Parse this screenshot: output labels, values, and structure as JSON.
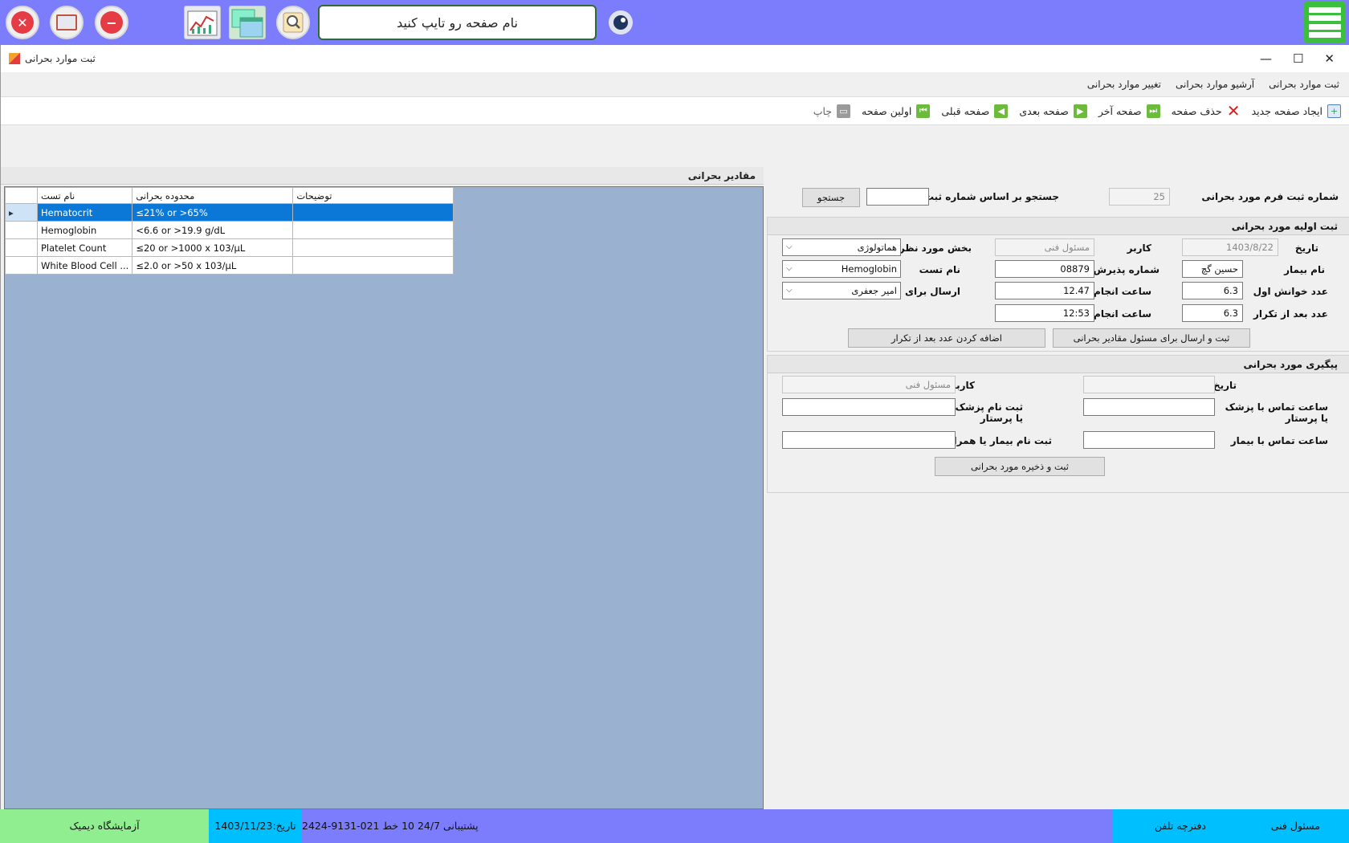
{
  "topbar": {
    "search_placeholder": "نام صفحه رو تایپ کنید",
    "icons": [
      "close-circle-icon",
      "monitor-icon",
      "minus-circle-icon",
      "chart-icon",
      "windows-icon",
      "magnifier-icon",
      "eye-icon",
      "hamburger-menu-icon"
    ]
  },
  "window": {
    "title": "ثبت موارد بحرانی",
    "tabs": [
      "ثبت موارد بحرانی",
      "آرشیو موارد بحرانی",
      "تغییر موارد بحرانی"
    ]
  },
  "toolbar": {
    "new_page": "ایجاد صفحه جدید",
    "delete_page": "حذف صفحه",
    "last_page": "صفحه آخر",
    "next_page": "صفحه بعدی",
    "prev_page": "صفحه قبلی",
    "first_page": "اولین صفحه",
    "print": "چاپ"
  },
  "grid": {
    "title": "مقادیر بحرانی",
    "columns": [
      "نام تست",
      "محدوده بحرانی",
      "توضیحات"
    ],
    "rows": [
      {
        "test": "Hematocrit",
        "range": "≤21% or >65%",
        "notes": ""
      },
      {
        "test": "Hemoglobin",
        "range": "<6.6 or >19.9 g/dL",
        "notes": ""
      },
      {
        "test": "Platelet Count",
        "range": "≤20 or >1000 x 103/µL",
        "notes": ""
      },
      {
        "test": "White Blood Cell ...",
        "range": "≤2.0 or >50 x 103/µL",
        "notes": ""
      }
    ],
    "selected_row": 0
  },
  "form": {
    "search": {
      "form_number_label": "شماره ثبت فرم مورد بحرانی",
      "form_number_value": "25",
      "search_label": "جستجو بر اساس شماره ثبت",
      "search_value": "",
      "search_button": "جستجو"
    },
    "initial": {
      "header": "ثبت اولیه مورد بحرانی",
      "date_label": "تاریخ",
      "date_value": "1403/8/22",
      "user_label": "کاربر",
      "user_value": "مسئول فنی",
      "department_label": "بخش مورد نظر",
      "department_value": "هماتولوژی",
      "patient_label": "نام بیمار",
      "patient_value": "حسین گچ پزی",
      "admission_label": "شماره پذیرش",
      "admission_value": "08879",
      "test_label": "نام تست",
      "test_value": "Hemoglobin",
      "first_read_label": "عدد خوانش اول",
      "first_read_value": "6.3",
      "time_label_1": "ساعت انجام",
      "time_value_1": "12.47",
      "send_to_label": "ارسال برای",
      "send_to_value": "امیر جعفری",
      "after_repeat_label": "عدد بعد از تکرار",
      "after_repeat_value": "6.3",
      "time_label_2": "ساعت انجام",
      "time_value_2": "12:53",
      "submit_send_button": "ثبت و ارسال برای مسئول مقادیر بحرانی",
      "add_after_repeat_button": "اضافه کردن عدد بعد از تکرار"
    },
    "followup": {
      "header": "پیگیری مورد بحرانی",
      "date_label": "تاریخ",
      "date_value": "",
      "user_label": "کاربر",
      "user_value": "مسئول فنی",
      "doctor_contact_label_1": "ساعت تماس با پزشک",
      "doctor_contact_label_2": "یا پرستار",
      "doctor_contact_value": "",
      "doctor_name_label_1": "ثبت نام پزشک",
      "doctor_name_label_2": "یا پرستار",
      "doctor_name_value": "",
      "patient_contact_label": "ساعت تماس با بیمار",
      "patient_contact_value": "",
      "patient_name_label": "ثبت نام بیمار یا همراه",
      "patient_name_value": "",
      "save_button": "ثبت و ذخیره مورد بحرانی"
    }
  },
  "statusbar": {
    "lab_name": "آزمایشگاه دیمیک",
    "date": "تاریخ:1403/11/23",
    "support": "پشتیبانی 24/7   10 خط  021-9131-2424",
    "phonebook": "دفترچه تلفن",
    "user": "مسئول فنی"
  },
  "colors": {
    "topbar": "#7b7dfd",
    "hamburger": "#3cbf3c",
    "grid_background": "#9ab2d0",
    "selected_row": "#0b78d7",
    "lab_segment": "#90ee90",
    "date_segment": "#00bfff"
  }
}
